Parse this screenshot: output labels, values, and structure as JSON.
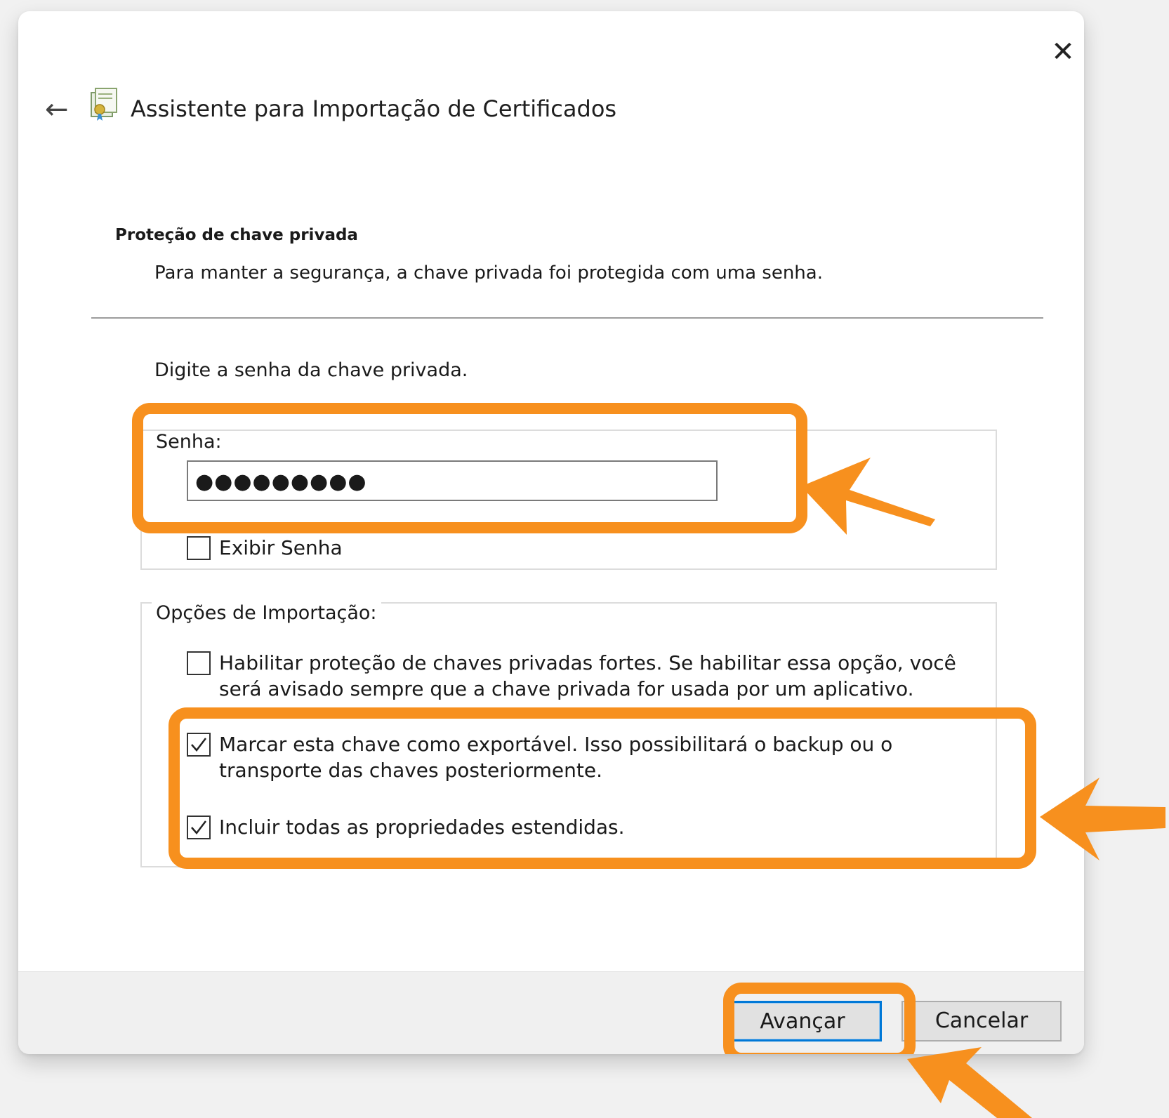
{
  "window": {
    "title": "Assistente para Importação de Certificados",
    "close_icon": "close-icon",
    "back_icon": "back-arrow-icon",
    "wizard_icon": "certificate-wizard-icon"
  },
  "header": {
    "section_heading": "Proteção de chave privada",
    "section_description": "Para manter a segurança, a chave privada foi protegida com uma senha."
  },
  "body": {
    "prompt": "Digite a senha da chave privada."
  },
  "password_group": {
    "legend": "Senha:",
    "value": "●●●●●●●●●",
    "show_password": {
      "label": "Exibir Senha",
      "checked": false
    }
  },
  "import_options": {
    "legend": "Opções de Importação:",
    "options": [
      {
        "label": "Habilitar proteção de chaves privadas fortes. Se habilitar essa opção, você será avisado sempre que a chave privada for usada por um aplicativo.",
        "checked": false
      },
      {
        "label": "Marcar esta chave como exportável. Isso possibilitará o backup ou o transporte das chaves posteriormente.",
        "checked": true
      },
      {
        "label": "Incluir todas as propriedades estendidas.",
        "checked": true
      }
    ]
  },
  "footer": {
    "next_label": "Avançar",
    "cancel_label": "Cancelar"
  },
  "annotations": {
    "highlight_color": "#f7901e",
    "arrow_icon": "pointer-arrow-icon"
  }
}
